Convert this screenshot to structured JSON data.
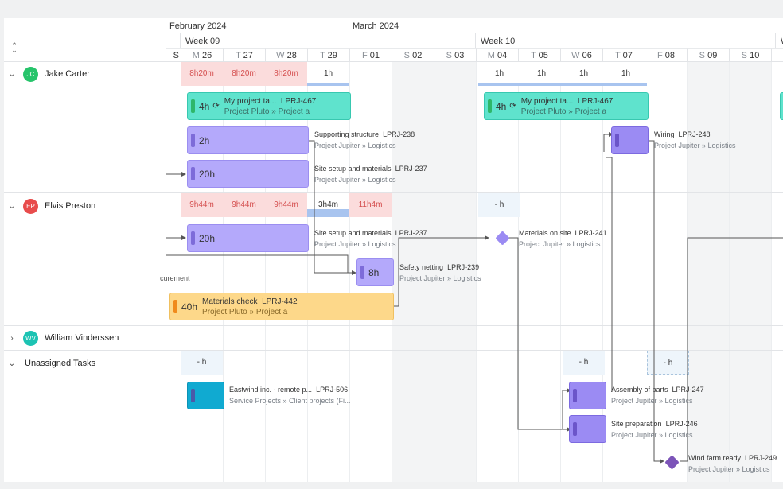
{
  "months": [
    {
      "label": "February 2024"
    },
    {
      "label": "March 2024"
    }
  ],
  "weeks": [
    {
      "label": "Week 09"
    },
    {
      "label": "Week 10"
    },
    {
      "label": "W"
    }
  ],
  "days": [
    {
      "l": "",
      "n": "S"
    },
    {
      "l": "M",
      "n": "26"
    },
    {
      "l": "T",
      "n": "27"
    },
    {
      "l": "W",
      "n": "28"
    },
    {
      "l": "T",
      "n": "29"
    },
    {
      "l": "F",
      "n": "01"
    },
    {
      "l": "S",
      "n": "02"
    },
    {
      "l": "S",
      "n": "03"
    },
    {
      "l": "M",
      "n": "04"
    },
    {
      "l": "T",
      "n": "05"
    },
    {
      "l": "W",
      "n": "06"
    },
    {
      "l": "T",
      "n": "07"
    },
    {
      "l": "F",
      "n": "08"
    },
    {
      "l": "S",
      "n": "09"
    },
    {
      "l": "S",
      "n": "10"
    },
    {
      "l": "",
      "n": ""
    }
  ],
  "collapse_icon": "⌃⌄",
  "resources": [
    {
      "name": "Jake Carter",
      "initials": "JC",
      "color": "#27c46b",
      "expanded": "⌄"
    },
    {
      "name": "Elvis Preston",
      "initials": "EP",
      "color": "#e84c4c",
      "expanded": "⌄"
    },
    {
      "name": "William Vinderssen",
      "initials": "WV",
      "color": "#1cc3b3",
      "expanded": "›"
    },
    {
      "name": "Unassigned Tasks",
      "initials": "",
      "color": "",
      "expanded": "⌄"
    }
  ],
  "capacity": {
    "jake": [
      "8h20m",
      "8h20m",
      "8h20m",
      "1h",
      "1h",
      "1h",
      "1h",
      "1h"
    ],
    "elvis": [
      "9h44m",
      "9h44m",
      "9h44m",
      "3h4m",
      "11h4m",
      "- h"
    ],
    "unassigned": [
      "- h",
      "- h",
      "- h"
    ]
  },
  "tasks": {
    "my_project_1": {
      "duration": "4h",
      "title": "My project ta...",
      "key": "LPRJ-467",
      "sub": "Project Pluto » Project a"
    },
    "my_project_2": {
      "duration": "4h",
      "title": "My project ta...",
      "key": "LPRJ-467",
      "sub": "Project Pluto » Project a"
    },
    "supporting": {
      "duration": "2h",
      "title": "Supporting structure",
      "key": "LPRJ-238",
      "sub": "Project Jupiter » Logistics"
    },
    "site_setup_jc": {
      "duration": "20h",
      "title": "Site setup and materials",
      "key": "LPRJ-237",
      "sub": "Project Jupiter » Logistics"
    },
    "wiring": {
      "duration": "",
      "title": "Wiring",
      "key": "LPRJ-248",
      "sub": "Project Jupiter » Logistics"
    },
    "site_setup_ep": {
      "duration": "20h",
      "title": "Site setup and materials",
      "key": "LPRJ-237",
      "sub": "Project Jupiter » Logistics"
    },
    "materials_on_site": {
      "title": "Materials on site",
      "key": "LPRJ-241",
      "sub": "Project Jupiter » Logistics"
    },
    "safety": {
      "duration": "8h",
      "title": "Safety netting",
      "key": "LPRJ-239",
      "sub": "Project Jupiter » Logistics"
    },
    "procurement_fragment": {
      "text": "curement"
    },
    "materials_check": {
      "duration": "40h",
      "title": "Materials check",
      "key": "LPRJ-442",
      "sub": "Project Pluto » Project a"
    },
    "eastwind": {
      "duration": "",
      "title": "Eastwind inc. - remote p...",
      "key": "LPRJ-506",
      "sub": "Service Projects » Client projects (Fi..."
    },
    "assembly": {
      "duration": "",
      "title": "Assembly of parts",
      "key": "LPRJ-247",
      "sub": "Project Jupiter » Logistics"
    },
    "site_prep": {
      "duration": "",
      "title": "Site preparation",
      "key": "LPRJ-246",
      "sub": "Project Jupiter » Logistics"
    },
    "wind_farm": {
      "title": "Wind farm ready",
      "key": "LPRJ-249",
      "sub": "Project Jupiter » Logistics"
    }
  },
  "colors": {
    "green_task": "#5fe3cd",
    "purple_task": "#b4a9fb",
    "orange_task": "#fdd88a",
    "cyan_task": "#10aad1",
    "overload": "#fbdcdc",
    "milestone_light": "#9b8bf3",
    "milestone_dark": "#7c54b8"
  },
  "icons": {
    "recurring": "⟳"
  }
}
